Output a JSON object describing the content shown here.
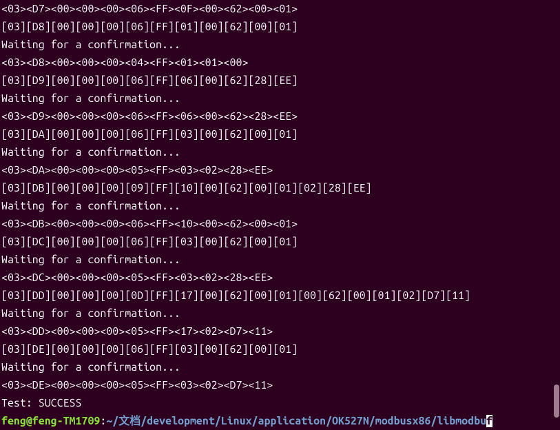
{
  "terminal": {
    "lines": [
      "<03><D7><00><00><00><06><FF><0F><00><62><00><01>",
      "[03][D8][00][00][00][06][FF][01][00][62][00][01]",
      "Waiting for a confirmation...",
      "<03><D8><00><00><00><04><FF><01><01><00>",
      "[03][D9][00][00][00][06][FF][06][00][62][28][EE]",
      "Waiting for a confirmation...",
      "<03><D9><00><00><00><06><FF><06><00><62><28><EE>",
      "[03][DA][00][00][00][06][FF][03][00][62][00][01]",
      "Waiting for a confirmation...",
      "<03><DA><00><00><00><05><FF><03><02><28><EE>",
      "[03][DB][00][00][00][09][FF][10][00][62][00][01][02][28][EE]",
      "Waiting for a confirmation...",
      "<03><DB><00><00><00><06><FF><10><00><62><00><01>",
      "[03][DC][00][00][00][06][FF][03][00][62][00][01]",
      "Waiting for a confirmation...",
      "<03><DC><00><00><00><05><FF><03><02><28><EE>",
      "[03][DD][00][00][00][0D][FF][17][00][62][00][01][00][62][00][01][02][D7][11]",
      "Waiting for a confirmation...",
      "<03><DD><00><00><00><05><FF><17><02><D7><11>",
      "[03][DE][00][00][00][06][FF][03][00][62][00][01]",
      "Waiting for a confirmation...",
      "<03><DE><00><00><00><05><FF><03><02><D7><11>",
      "Test: SUCCESS"
    ],
    "prompt": {
      "user_host": "feng@feng-TM1709",
      "colon": ":",
      "path": "~/文档/development/Linux/application/OK527N/modbusx86/libmodbu",
      "cursor_char": "f"
    }
  }
}
